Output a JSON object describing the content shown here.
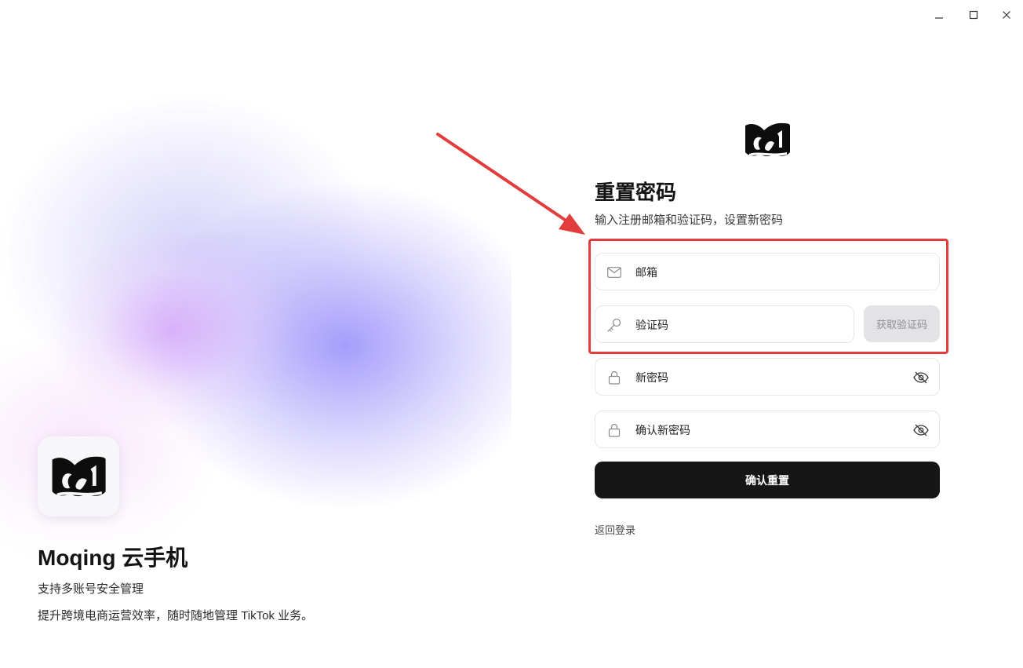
{
  "window": {
    "minimize_icon": "minimize-icon",
    "maximize_icon": "maximize-icon",
    "close_icon": "close-icon"
  },
  "hero": {
    "app_name": "Moqing 云手机",
    "tagline": "支持多账号安全管理",
    "description": "提升跨境电商运营效率，随时随地管理 TikTok 业务。"
  },
  "form": {
    "title": "重置密码",
    "subtitle": "输入注册邮箱和验证码，设置新密码",
    "email_label": "邮箱",
    "code_label": "验证码",
    "get_code_button": "获取验证码",
    "new_password_label": "新密码",
    "confirm_password_label": "确认新密码",
    "submit_button": "确认重置",
    "back_link": "返回登录"
  },
  "colors": {
    "accent_dark": "#161616",
    "highlight_red": "#e23c3c",
    "disabled_button": "#e3e3e6"
  }
}
